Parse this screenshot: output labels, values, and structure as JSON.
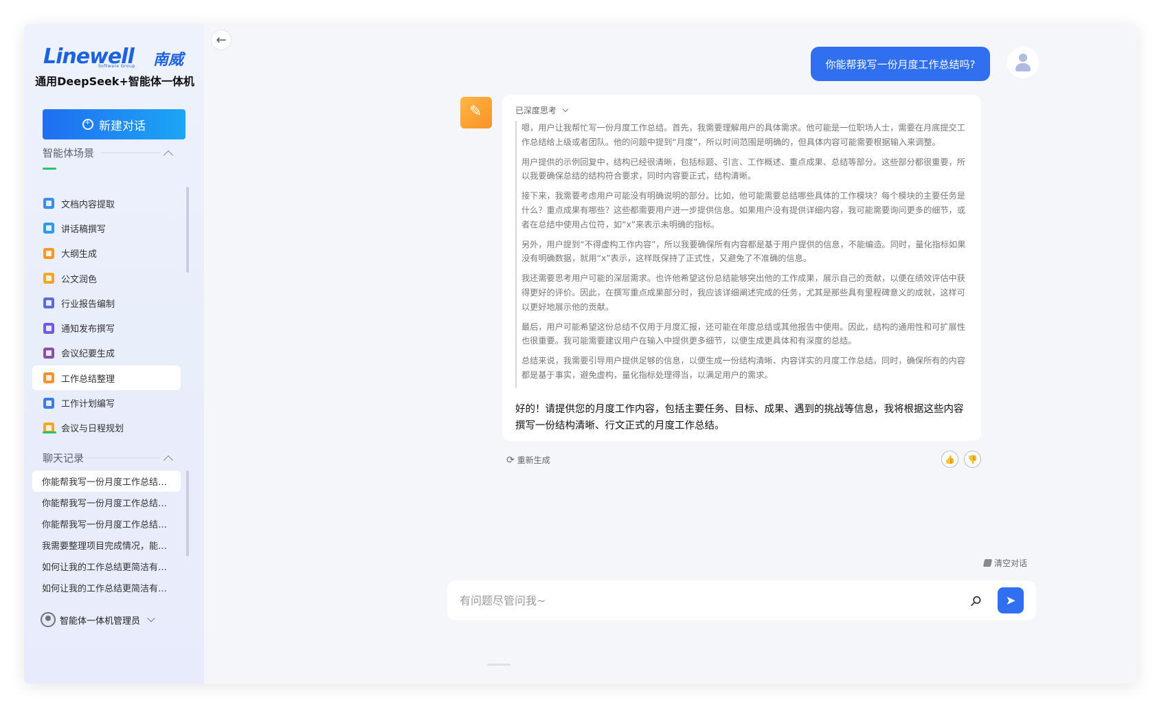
{
  "sidebar": {
    "logo_text": "Linewell",
    "logo_cn": "南威",
    "logo_sub": "Software Group",
    "product_name": "通用DeepSeek+智能体一体机",
    "new_chat_label": "新建对话",
    "scenes_title": "智能体场景",
    "scenes": [
      {
        "label": "文档内容提取",
        "icon": "doc-extract-icon",
        "color": "#3a8de8"
      },
      {
        "label": "讲话稿撰写",
        "icon": "speech-icon",
        "color": "#2b9de8"
      },
      {
        "label": "大纲生成",
        "icon": "outline-icon",
        "color": "#f59a23"
      },
      {
        "label": "公文润色",
        "icon": "polish-icon",
        "color": "#f5a623"
      },
      {
        "label": "行业报告编制",
        "icon": "report-icon",
        "color": "#5b6bd8"
      },
      {
        "label": "通知发布撰写",
        "icon": "notice-icon",
        "color": "#6c5ce7"
      },
      {
        "label": "会议纪要生成",
        "icon": "minutes-icon",
        "color": "#8a4fa8"
      },
      {
        "label": "工作总结整理",
        "icon": "summary-icon",
        "color": "#f7932a"
      },
      {
        "label": "工作计划编写",
        "icon": "plan-icon",
        "color": "#3a7bef"
      },
      {
        "label": "会议与日程规划",
        "icon": "schedule-icon",
        "color": "#f5a623"
      }
    ],
    "active_scene_index": 7,
    "history_title": "聊天记录",
    "history": [
      "你能帮我写一份月度工作总结吗?",
      "你能帮我写一份月度工作总结吗?",
      "你能帮我写一份月度工作总结吗?",
      "我需要整理项目完成情况，能帮我吗?",
      "如何让我的工作总结更简洁有力?",
      "如何让我的工作总结更简洁有力?"
    ],
    "active_history_index": 0,
    "user_name": "智能体一体机管理员"
  },
  "chat": {
    "user_message": "你能帮我写一份月度工作总结吗?",
    "thinking_label": "已深度思考",
    "thinking_paragraphs": [
      "嗯，用户让我帮忙写一份月度工作总结。首先，我需要理解用户的具体需求。他可能是一位职场人士，需要在月底提交工作总结给上级或者团队。他的问题中提到“月度”，所以时间范围是明确的，但具体内容可能需要根据输入来调整。",
      "用户提供的示例回复中，结构已经很清晰，包括标题、引言、工作概述、重点成果、总结等部分。这些部分都很重要，所以我要确保总结的结构符合要求，同时内容要正式，结构清晰。",
      "接下来，我需要考虑用户可能没有明确说明的部分。比如，他可能需要总结哪些具体的工作模块？每个模块的主要任务是什么？重点成果有哪些？这些都需要用户进一步提供信息。如果用户没有提供详细内容，我可能需要询问更多的细节，或者在总结中使用占位符，如“x”来表示未明确的指标。",
      "另外，用户提到“不得虚构工作内容”，所以我要确保所有内容都是基于用户提供的信息，不能编造。同时，量化指标如果没有明确数据，就用“x”表示，这样既保持了正式性，又避免了不准确的信息。",
      "我还需要思考用户可能的深层需求。也许他希望这份总结能够突出他的工作成果，展示自己的贡献，以便在绩效评估中获得更好的评价。因此，在撰写重点成果部分时，我应该详细阐述完成的任务，尤其是那些具有里程碑意义的成就，这样可以更好地展示他的贡献。",
      "最后，用户可能希望这份总结不仅用于月度汇报，还可能在年度总结或其他报告中使用。因此，结构的通用性和可扩展性也很重要。我可能需要建议用户在输入中提供更多细节，以便生成更具体和有深度的总结。",
      "总结来说，我需要引导用户提供足够的信息，以便生成一份结构清晰、内容详实的月度工作总结。同时，确保所有的内容都是基于事实，避免虚构，量化指标处理得当，以满足用户的需求。"
    ],
    "final_answer": "好的！请提供您的月度工作内容，包括主要任务、目标、成果、遇到的挑战等信息，我将根据这些内容撰写一份结构清晰、行文正式的月度工作总结。",
    "regenerate_label": "重新生成",
    "clear_label": "清空对话",
    "input_placeholder": "有问题尽管问我~"
  }
}
